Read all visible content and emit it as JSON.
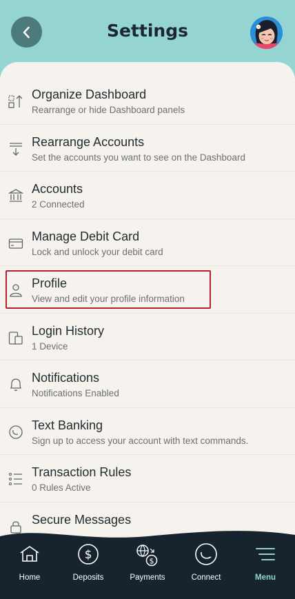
{
  "header": {
    "title": "Settings"
  },
  "settings": [
    {
      "label": "Organize Dashboard",
      "sub": "Rearrange or hide Dashboard panels",
      "icon": "organize-dashboard-icon"
    },
    {
      "label": "Rearrange Accounts",
      "sub": "Set the accounts you want to see on the Dashboard",
      "icon": "rearrange-accounts-icon"
    },
    {
      "label": "Accounts",
      "sub": "2 Connected",
      "icon": "bank-icon"
    },
    {
      "label": "Manage Debit Card",
      "sub": "Lock and unlock your debit card",
      "icon": "credit-card-icon"
    },
    {
      "label": "Profile",
      "sub": "View and edit your profile information",
      "icon": "user-icon"
    },
    {
      "label": "Login History",
      "sub": "1 Device",
      "icon": "devices-icon"
    },
    {
      "label": "Notifications",
      "sub": "Notifications Enabled",
      "icon": "bell-icon"
    },
    {
      "label": "Text Banking",
      "sub": "Sign up to access your account with text commands.",
      "icon": "text-banking-icon"
    },
    {
      "label": "Transaction Rules",
      "sub": "0 Rules Active",
      "icon": "list-icon"
    },
    {
      "label": "Secure Messages",
      "sub": "",
      "icon": "lock-icon"
    }
  ],
  "nav": {
    "items": [
      {
        "label": "Home",
        "icon": "home-icon"
      },
      {
        "label": "Deposits",
        "icon": "deposits-icon"
      },
      {
        "label": "Payments",
        "icon": "payments-icon"
      },
      {
        "label": "Connect",
        "icon": "connect-icon"
      },
      {
        "label": "Menu",
        "icon": "menu-icon",
        "active": true
      }
    ]
  },
  "colors": {
    "header_bg": "#94d5d3",
    "sheet_bg": "#f6f3ef",
    "nav_bg": "#18242d",
    "accent": "#8fd6d2",
    "highlight": "#b3202a"
  }
}
